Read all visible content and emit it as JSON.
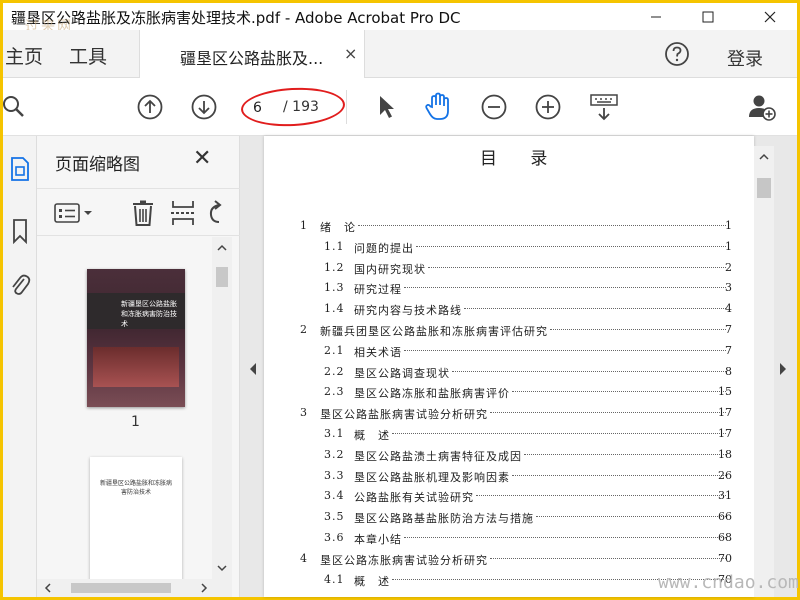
{
  "window": {
    "title": "疆垦区公路盐胀及冻胀病害处理技术.pdf - Adobe Acrobat Pro DC",
    "watermark": "过来网"
  },
  "tabbar": {
    "home_label": "主页",
    "tools_label": "工具",
    "doc_tab_label": "疆垦区公路盐胀及...",
    "close_glyph": "×",
    "login_label": "登录"
  },
  "toolbar": {
    "current_page": "6",
    "total_pages": "/ 193"
  },
  "thumbnail_panel": {
    "title": "页面缩略图",
    "close_glyph": "✕",
    "thumb1_title": "新疆垦区公路盐胀和冻胀病害防治技术",
    "thumb1_page": "1",
    "thumb2_title": "新疆垦区公路盐胀和冻胀病害防治技术"
  },
  "document": {
    "heading": "目 录",
    "toc": [
      {
        "level": 1,
        "num": "1",
        "title": "绪　论",
        "page": "1"
      },
      {
        "level": 2,
        "num": "1.1",
        "title": "问题的提出",
        "page": "1"
      },
      {
        "level": 2,
        "num": "1.2",
        "title": "国内研究现状",
        "page": "2"
      },
      {
        "level": 2,
        "num": "1.3",
        "title": "研究过程",
        "page": "3"
      },
      {
        "level": 2,
        "num": "1.4",
        "title": "研究内容与技术路线",
        "page": "4"
      },
      {
        "level": 1,
        "num": "2",
        "title": "新疆兵团垦区公路盐胀和冻胀病害评估研究",
        "page": "7"
      },
      {
        "level": 2,
        "num": "2.1",
        "title": "相关术语",
        "page": "7"
      },
      {
        "level": 2,
        "num": "2.2",
        "title": "垦区公路调查现状",
        "page": "8"
      },
      {
        "level": 2,
        "num": "2.3",
        "title": "垦区公路冻胀和盐胀病害评价",
        "page": "15"
      },
      {
        "level": 1,
        "num": "3",
        "title": "垦区公路盐胀病害试验分析研究",
        "page": "17"
      },
      {
        "level": 2,
        "num": "3.1",
        "title": "概　述",
        "page": "17"
      },
      {
        "level": 2,
        "num": "3.2",
        "title": "垦区公路盐渍土病害特征及成因",
        "page": "18"
      },
      {
        "level": 2,
        "num": "3.3",
        "title": "垦区公路盐胀机理及影响因素",
        "page": "26"
      },
      {
        "level": 2,
        "num": "3.4",
        "title": "公路盐胀有关试验研究",
        "page": "31"
      },
      {
        "level": 2,
        "num": "3.5",
        "title": "垦区公路路基盐胀防治方法与措施",
        "page": "66"
      },
      {
        "level": 2,
        "num": "3.6",
        "title": "本章小结",
        "page": "68"
      },
      {
        "level": 1,
        "num": "4",
        "title": "垦区公路冻胀病害试验分析研究",
        "page": "70"
      },
      {
        "level": 2,
        "num": "4.1",
        "title": "概　述",
        "page": "70"
      }
    ],
    "site_watermark": "www.cndao.com"
  },
  "colors": {
    "frame": "#f5c400",
    "annotation_ring": "#e11d1d",
    "accent_hand": "#1473e6"
  },
  "icons": {
    "toolbar": [
      "search-icon",
      "arrow-up-circle-icon",
      "arrow-down-circle-icon",
      "select-cursor-icon",
      "hand-icon",
      "zoom-out-icon",
      "zoom-in-icon",
      "keyboard-scroll-icon",
      "add-user-icon"
    ],
    "rail": [
      "page-thumbnails-icon",
      "bookmark-icon",
      "attachment-icon"
    ]
  }
}
